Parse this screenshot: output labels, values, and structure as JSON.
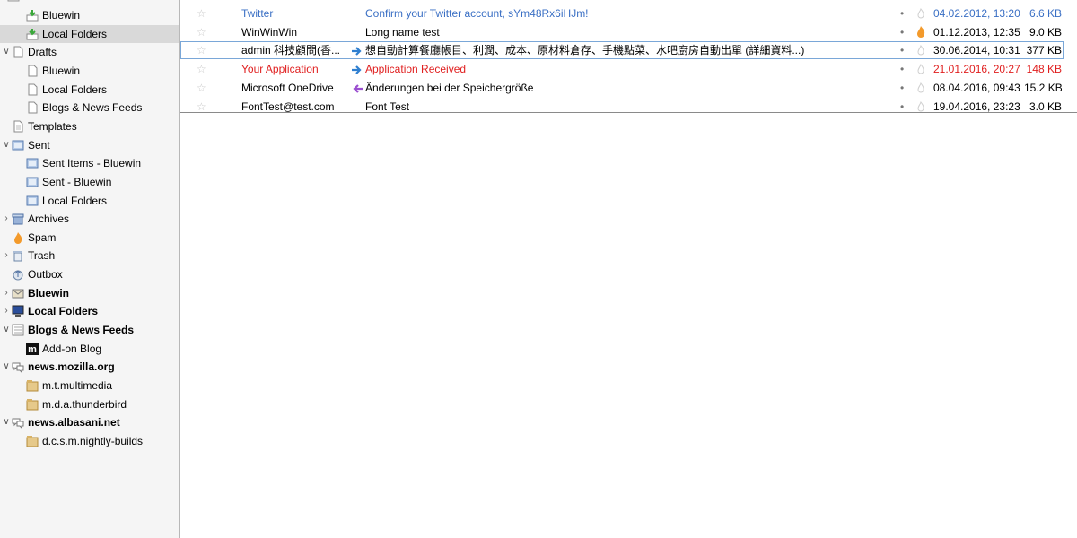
{
  "sidebar": {
    "rows": [
      {
        "label": "Bluewin",
        "icon": "inbox-icon",
        "indent": 2,
        "bold": false,
        "twisty": "",
        "selected": false
      },
      {
        "label": "Local Folders",
        "icon": "inbox-icon",
        "indent": 2,
        "bold": false,
        "twisty": "",
        "selected": true
      },
      {
        "label": "Drafts",
        "icon": "drafts-icon",
        "indent": 1,
        "bold": false,
        "twisty": "v",
        "selected": false
      },
      {
        "label": "Bluewin",
        "icon": "drafts-icon",
        "indent": 2,
        "bold": false,
        "twisty": "",
        "selected": false
      },
      {
        "label": "Local Folders",
        "icon": "drafts-icon",
        "indent": 2,
        "bold": false,
        "twisty": "",
        "selected": false
      },
      {
        "label": "Blogs & News Feeds",
        "icon": "drafts-icon",
        "indent": 2,
        "bold": false,
        "twisty": "",
        "selected": false
      },
      {
        "label": "Templates",
        "icon": "templates-icon",
        "indent": 1,
        "bold": false,
        "twisty": "",
        "selected": false
      },
      {
        "label": "Sent",
        "icon": "sent-icon",
        "indent": 1,
        "bold": false,
        "twisty": "v",
        "selected": false
      },
      {
        "label": "Sent Items - Bluewin",
        "icon": "sent-icon",
        "indent": 2,
        "bold": false,
        "twisty": "",
        "selected": false
      },
      {
        "label": "Sent - Bluewin",
        "icon": "sent-icon",
        "indent": 2,
        "bold": false,
        "twisty": "",
        "selected": false
      },
      {
        "label": "Local Folders",
        "icon": "sent-icon",
        "indent": 2,
        "bold": false,
        "twisty": "",
        "selected": false
      },
      {
        "label": "Archives",
        "icon": "archives-icon",
        "indent": 1,
        "bold": false,
        "twisty": ">",
        "selected": false
      },
      {
        "label": "Spam",
        "icon": "spam-icon",
        "indent": 1,
        "bold": false,
        "twisty": "",
        "selected": false
      },
      {
        "label": "Trash",
        "icon": "trash-icon",
        "indent": 1,
        "bold": false,
        "twisty": ">",
        "selected": false
      },
      {
        "label": "Outbox",
        "icon": "outbox-icon",
        "indent": 1,
        "bold": false,
        "twisty": "",
        "selected": false
      },
      {
        "label": "Bluewin",
        "icon": "account-icon",
        "indent": 1,
        "bold": true,
        "twisty": ">",
        "selected": false
      },
      {
        "label": "Local Folders",
        "icon": "computer-icon",
        "indent": 1,
        "bold": true,
        "twisty": ">",
        "selected": false
      },
      {
        "label": "Blogs & News Feeds",
        "icon": "feeds-icon",
        "indent": 1,
        "bold": true,
        "twisty": "v",
        "selected": false
      },
      {
        "label": "Add-on Blog",
        "icon": "mozilla-m-icon",
        "indent": 2,
        "bold": false,
        "twisty": "",
        "selected": false
      },
      {
        "label": "news.mozilla.org",
        "icon": "newsgroup-server-icon",
        "indent": 1,
        "bold": true,
        "twisty": "v",
        "selected": false
      },
      {
        "label": "m.t.multimedia",
        "icon": "newsgroup-icon",
        "indent": 2,
        "bold": false,
        "twisty": "",
        "selected": false
      },
      {
        "label": "m.d.a.thunderbird",
        "icon": "newsgroup-icon",
        "indent": 2,
        "bold": false,
        "twisty": "",
        "selected": false
      },
      {
        "label": "news.albasani.net",
        "icon": "newsgroup-server-icon",
        "indent": 1,
        "bold": true,
        "twisty": "v",
        "selected": false
      },
      {
        "label": "d.c.s.m.nightly-builds",
        "icon": "newsgroup-icon",
        "indent": 2,
        "bold": false,
        "twisty": "",
        "selected": false
      }
    ]
  },
  "messages": [
    {
      "sender": "Twitter",
      "subject": "Confirm your Twitter account, sYm48Rx6iHJm!",
      "status": "",
      "date": "04.02.2012, 13:20",
      "size": "6.6 KB",
      "color": "blue",
      "junk": false,
      "focused": false
    },
    {
      "sender": "WinWinWin",
      "subject": "Long name test",
      "status": "",
      "date": "01.12.2013, 12:35",
      "size": "9.0 KB",
      "color": "normal",
      "junk": true,
      "focused": false
    },
    {
      "sender": "admin 科技顧問(香...",
      "subject": "想自動計算餐廳帳目、利潤、成本、原材料倉存、手機點菜、水吧廚房自動出單 (詳細資料...)",
      "status": "forwarded",
      "date": "30.06.2014, 10:31",
      "size": "377 KB",
      "color": "normal",
      "junk": false,
      "focused": true
    },
    {
      "sender": "Your Application",
      "subject": "Application Received",
      "status": "forwarded",
      "date": "21.01.2016, 20:27",
      "size": "148 KB",
      "color": "red",
      "junk": false,
      "focused": false
    },
    {
      "sender": "Microsoft OneDrive",
      "subject": "Änderungen bei der Speichergröße",
      "status": "replied",
      "date": "08.04.2016, 09:43",
      "size": "15.2 KB",
      "color": "normal",
      "junk": false,
      "focused": false
    },
    {
      "sender": "FontTest@test.com",
      "subject": "Font Test",
      "status": "",
      "date": "19.04.2016, 23:23",
      "size": "3.0 KB",
      "color": "normal",
      "junk": false,
      "focused": false
    }
  ],
  "colors": {
    "unread_blue": "#3a6fc4",
    "tag_red": "#e02020",
    "selection": "#d9d9d9"
  }
}
